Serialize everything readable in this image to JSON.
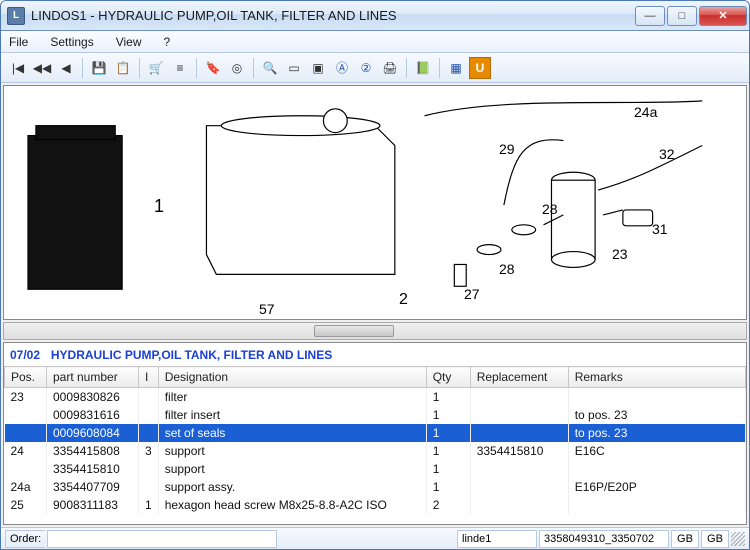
{
  "window": {
    "title": "LINDOS1 - HYDRAULIC PUMP,OIL TANK,  FILTER AND LINES"
  },
  "menu": {
    "file": "File",
    "settings": "Settings",
    "view": "View",
    "help": "?"
  },
  "toolbar": {
    "u": "U"
  },
  "diagram": {
    "callouts": {
      "1": "1",
      "2": "2",
      "23": "23",
      "24a": "24a",
      "27": "27",
      "28a": "28",
      "28b": "28",
      "29": "29",
      "31": "31",
      "32": "32",
      "57": "57"
    }
  },
  "section": {
    "code": "07/02",
    "title": "HYDRAULIC PUMP,OIL TANK,  FILTER AND LINES"
  },
  "columns": {
    "pos": "Pos.",
    "pn": "part number",
    "i": "I",
    "desig": "Designation",
    "qty": "Qty",
    "repl": "Replacement",
    "rem": "Remarks"
  },
  "rows": [
    {
      "pos": "23",
      "pn": "0009830826",
      "i": "",
      "desig": "filter",
      "qty": "1",
      "repl": "",
      "rem": ""
    },
    {
      "pos": "",
      "pn": "0009831616",
      "i": "",
      "desig": "filter insert",
      "qty": "1",
      "repl": "",
      "rem": "to pos. 23"
    },
    {
      "pos": "",
      "pn": "0009608084",
      "i": "",
      "desig": "set of seals",
      "qty": "1",
      "repl": "",
      "rem": "to pos. 23"
    },
    {
      "pos": "24",
      "pn": "3354415808",
      "i": "3",
      "desig": "support",
      "qty": "1",
      "repl": "3354415810",
      "rem": "E16C"
    },
    {
      "pos": "",
      "pn": "3354415810",
      "i": "",
      "desig": "support",
      "qty": "1",
      "repl": "",
      "rem": ""
    },
    {
      "pos": "24a",
      "pn": "3354407709",
      "i": "",
      "desig": "support assy.",
      "qty": "1",
      "repl": "",
      "rem": "E16P/E20P"
    },
    {
      "pos": "25",
      "pn": "9008311183",
      "i": "1",
      "desig": "hexagon head screw M8x25-8.8-A2C  ISO",
      "qty": "2",
      "repl": "",
      "rem": ""
    }
  ],
  "status": {
    "orderLabel": "Order:",
    "orderVal": "",
    "linde": "linde1",
    "code": "3358049310_3350702",
    "gb1": "GB",
    "gb2": "GB"
  }
}
